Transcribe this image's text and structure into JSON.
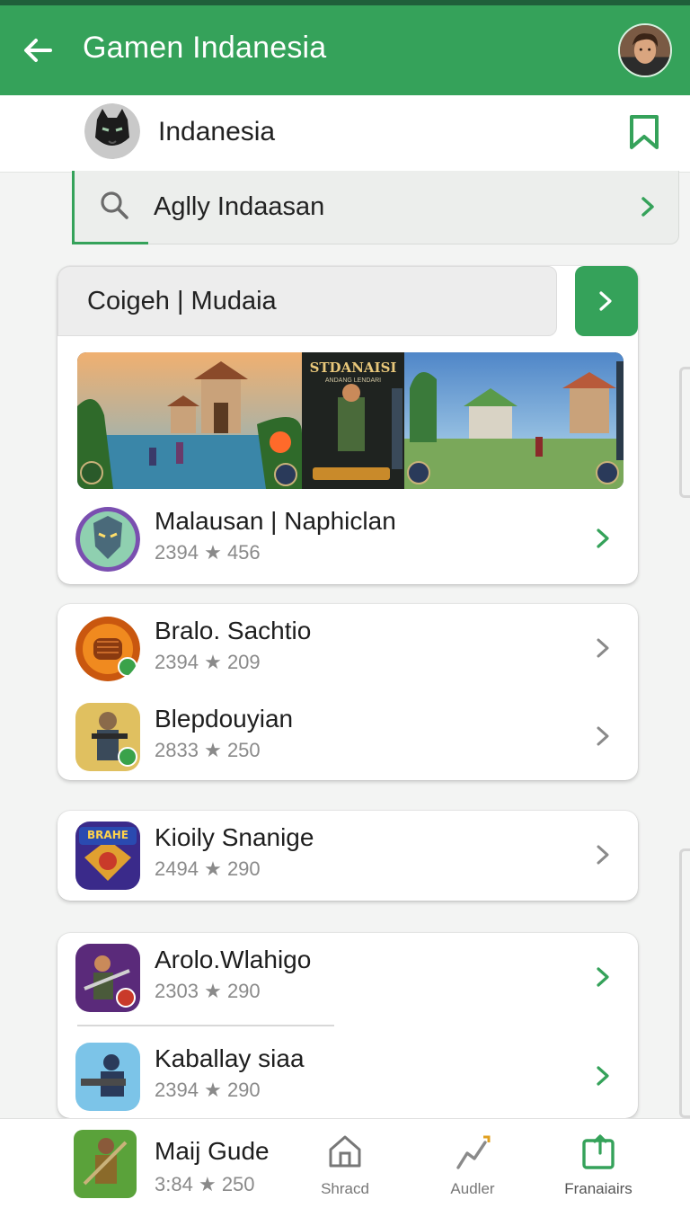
{
  "appbar": {
    "title": "Gamen Indanesia"
  },
  "profile": {
    "name": "Indanesia"
  },
  "search": {
    "value": "Aglly Indaasan"
  },
  "section": {
    "header": "Coigeh | Mudaia"
  },
  "banner": {
    "overlay_title": "STDANAISI",
    "overlay_subtitle": "ANDANG LENDARI"
  },
  "games": [
    {
      "title": "Malausan | Naphiclan",
      "meta_left": "2394",
      "meta_right": "456"
    },
    {
      "title": "Bralo. Sachtio",
      "meta_left": "2394",
      "meta_right": "209"
    },
    {
      "title": "Blepdouyian",
      "meta_left": "2833",
      "meta_right": "250"
    },
    {
      "title": "Kioily Snanige",
      "meta_left": "2494",
      "meta_right": "290",
      "icon_text": "BRAHE"
    },
    {
      "title": "Arolo.Wlahigo",
      "meta_left": "2303",
      "meta_right": "290"
    },
    {
      "title": "Kaballay siaa",
      "meta_left": "2394",
      "meta_right": "290"
    }
  ],
  "bottom": {
    "featured": {
      "title": "Maij Gude",
      "meta_left": "3:84",
      "meta_right": "250"
    },
    "nav": [
      {
        "label": "Shracd",
        "icon": "home-icon"
      },
      {
        "label": "Audler",
        "icon": "analytics-icon"
      },
      {
        "label": "Franaiairs",
        "icon": "share-icon"
      }
    ]
  },
  "colors": {
    "accent": "#35a25a",
    "dark_strip": "#1f5f3a"
  }
}
